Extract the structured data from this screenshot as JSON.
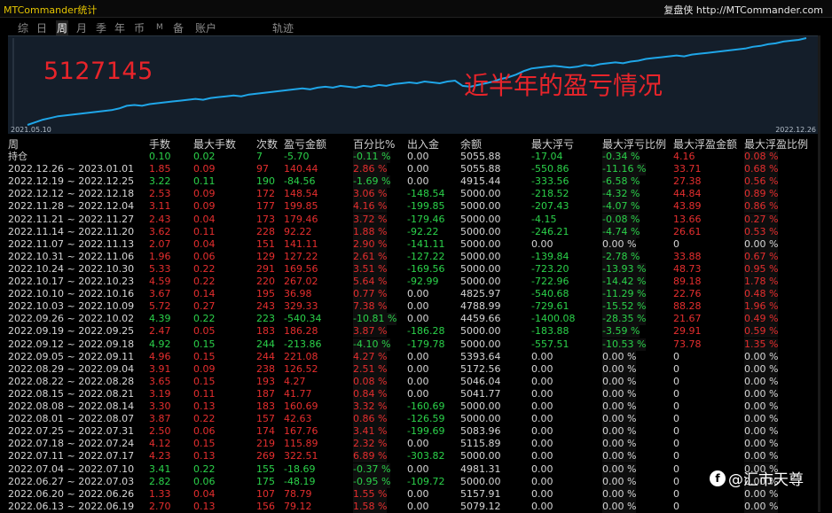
{
  "window": {
    "title": "MTCommander统计",
    "brand": "复盘侠 http://MTCommander.com"
  },
  "tabs": [
    {
      "label": "综",
      "active": false
    },
    {
      "label": "日",
      "active": false
    },
    {
      "label": "周",
      "active": true
    },
    {
      "label": "月",
      "active": false
    },
    {
      "label": "季",
      "active": false
    },
    {
      "label": "年",
      "active": false
    },
    {
      "label": "币",
      "active": false
    },
    {
      "label": "M",
      "active": false
    },
    {
      "label": "备",
      "active": false
    },
    {
      "label": "账户",
      "active": false
    },
    {
      "label": "轨迹",
      "active": false
    }
  ],
  "chart": {
    "overlay_number": "5127145",
    "overlay_caption": "近半年的盈亏情况",
    "date_start": "2021.05.10",
    "date_end": "2022.12.26",
    "line_color": "#1fa6e8",
    "points": [
      0.0,
      0.03,
      0.06,
      0.08,
      0.1,
      0.11,
      0.12,
      0.13,
      0.14,
      0.15,
      0.16,
      0.17,
      0.19,
      0.22,
      0.23,
      0.22,
      0.24,
      0.25,
      0.26,
      0.27,
      0.28,
      0.29,
      0.3,
      0.29,
      0.31,
      0.32,
      0.33,
      0.34,
      0.33,
      0.35,
      0.36,
      0.37,
      0.38,
      0.39,
      0.4,
      0.41,
      0.42,
      0.41,
      0.43,
      0.44,
      0.43,
      0.45,
      0.44,
      0.43,
      0.45,
      0.44,
      0.46,
      0.45,
      0.47,
      0.48,
      0.49,
      0.48,
      0.5,
      0.49,
      0.48,
      0.5,
      0.51,
      0.45,
      0.44,
      0.46,
      0.48,
      0.5,
      0.53,
      0.55,
      0.58,
      0.62,
      0.65,
      0.66,
      0.67,
      0.68,
      0.67,
      0.66,
      0.67,
      0.69,
      0.68,
      0.7,
      0.71,
      0.72,
      0.71,
      0.73,
      0.74,
      0.76,
      0.77,
      0.78,
      0.79,
      0.8,
      0.79,
      0.81,
      0.82,
      0.83,
      0.84,
      0.85,
      0.86,
      0.87,
      0.88,
      0.9,
      0.91,
      0.93,
      0.94,
      0.96,
      0.97,
      0.98,
      1.0
    ]
  },
  "table": {
    "headers": [
      "周",
      "手数",
      "最大手数",
      "次数",
      "盈亏金额",
      "百分比%",
      "出入金",
      "余额",
      "最大浮亏",
      "最大浮亏比例",
      "最大浮盈金额",
      "最大浮盈比例"
    ],
    "holding_row": {
      "period": "持仓",
      "lots": "0.10",
      "max_lots": "0.02",
      "count": "7",
      "pnl": "-5.70",
      "pct": "-0.11 %",
      "flow": "0.00",
      "balance": "5055.88",
      "max_dd": "-17.04",
      "max_dd_pct": "-0.34 %",
      "max_fp": "4.16",
      "max_fp_pct": "0.08 %",
      "sign": "neg"
    },
    "rows": [
      {
        "period": "2022.12.26 ~ 2023.01.01",
        "lots": "1.85",
        "max_lots": "0.09",
        "count": "97",
        "pnl": "140.44",
        "pct": "2.86 %",
        "flow": "0.00",
        "balance": "5055.88",
        "max_dd": "-550.86",
        "max_dd_pct": "-11.16 %",
        "max_fp": "33.71",
        "max_fp_pct": "0.68 %",
        "sign": "pos"
      },
      {
        "period": "2022.12.19 ~ 2022.12.25",
        "lots": "3.22",
        "max_lots": "0.11",
        "count": "190",
        "pnl": "-84.56",
        "pct": "-1.69 %",
        "flow": "0.00",
        "balance": "4915.44",
        "max_dd": "-333.56",
        "max_dd_pct": "-6.58 %",
        "max_fp": "27.38",
        "max_fp_pct": "0.56 %",
        "sign": "neg"
      },
      {
        "period": "2022.12.12 ~ 2022.12.18",
        "lots": "2.53",
        "max_lots": "0.09",
        "count": "172",
        "pnl": "148.54",
        "pct": "3.06 %",
        "flow": "-148.54",
        "balance": "5000.00",
        "max_dd": "-218.52",
        "max_dd_pct": "-4.32 %",
        "max_fp": "44.84",
        "max_fp_pct": "0.89 %",
        "sign": "pos"
      },
      {
        "period": "2022.11.28 ~ 2022.12.04",
        "lots": "3.11",
        "max_lots": "0.09",
        "count": "177",
        "pnl": "199.85",
        "pct": "4.16 %",
        "flow": "-199.85",
        "balance": "5000.00",
        "max_dd": "-207.43",
        "max_dd_pct": "-4.07 %",
        "max_fp": "43.89",
        "max_fp_pct": "0.86 %",
        "sign": "pos"
      },
      {
        "period": "2022.11.21 ~ 2022.11.27",
        "lots": "2.43",
        "max_lots": "0.04",
        "count": "173",
        "pnl": "179.46",
        "pct": "3.72 %",
        "flow": "-179.46",
        "balance": "5000.00",
        "max_dd": "-4.15",
        "max_dd_pct": "-0.08 %",
        "max_fp": "13.66",
        "max_fp_pct": "0.27 %",
        "sign": "pos"
      },
      {
        "period": "2022.11.14 ~ 2022.11.20",
        "lots": "3.62",
        "max_lots": "0.11",
        "count": "228",
        "pnl": "92.22",
        "pct": "1.88 %",
        "flow": "-92.22",
        "balance": "5000.00",
        "max_dd": "-246.21",
        "max_dd_pct": "-4.74 %",
        "max_fp": "26.61",
        "max_fp_pct": "0.53 %",
        "sign": "pos"
      },
      {
        "period": "2022.11.07 ~ 2022.11.13",
        "lots": "2.07",
        "max_lots": "0.04",
        "count": "151",
        "pnl": "141.11",
        "pct": "2.90 %",
        "flow": "-141.11",
        "balance": "5000.00",
        "max_dd": "0.00",
        "max_dd_pct": "0.00 %",
        "max_fp": "0",
        "max_fp_pct": "0.00 %",
        "sign": "pos"
      },
      {
        "period": "2022.10.31 ~ 2022.11.06",
        "lots": "1.96",
        "max_lots": "0.06",
        "count": "129",
        "pnl": "127.22",
        "pct": "2.61 %",
        "flow": "-127.22",
        "balance": "5000.00",
        "max_dd": "-139.84",
        "max_dd_pct": "-2.78 %",
        "max_fp": "33.88",
        "max_fp_pct": "0.67 %",
        "sign": "pos"
      },
      {
        "period": "2022.10.24 ~ 2022.10.30",
        "lots": "5.33",
        "max_lots": "0.22",
        "count": "291",
        "pnl": "169.56",
        "pct": "3.51 %",
        "flow": "-169.56",
        "balance": "5000.00",
        "max_dd": "-723.20",
        "max_dd_pct": "-13.93 %",
        "max_fp": "48.73",
        "max_fp_pct": "0.95 %",
        "sign": "pos"
      },
      {
        "period": "2022.10.17 ~ 2022.10.23",
        "lots": "4.59",
        "max_lots": "0.22",
        "count": "220",
        "pnl": "267.02",
        "pct": "5.64 %",
        "flow": "-92.99",
        "balance": "5000.00",
        "max_dd": "-722.96",
        "max_dd_pct": "-14.42 %",
        "max_fp": "89.18",
        "max_fp_pct": "1.78 %",
        "sign": "pos"
      },
      {
        "period": "2022.10.10 ~ 2022.10.16",
        "lots": "3.67",
        "max_lots": "0.14",
        "count": "195",
        "pnl": "36.98",
        "pct": "0.77 %",
        "flow": "0.00",
        "balance": "4825.97",
        "max_dd": "-540.68",
        "max_dd_pct": "-11.29 %",
        "max_fp": "22.76",
        "max_fp_pct": "0.48 %",
        "sign": "pos"
      },
      {
        "period": "2022.10.03 ~ 2022.10.09",
        "lots": "5.72",
        "max_lots": "0.27",
        "count": "243",
        "pnl": "329.33",
        "pct": "7.38 %",
        "flow": "0.00",
        "balance": "4788.99",
        "max_dd": "-729.61",
        "max_dd_pct": "-15.52 %",
        "max_fp": "88.28",
        "max_fp_pct": "1.96 %",
        "sign": "pos"
      },
      {
        "period": "2022.09.26 ~ 2022.10.02",
        "lots": "4.39",
        "max_lots": "0.22",
        "count": "223",
        "pnl": "-540.34",
        "pct": "-10.81 %",
        "flow": "0.00",
        "balance": "4459.66",
        "max_dd": "-1400.08",
        "max_dd_pct": "-28.35 %",
        "max_fp": "21.67",
        "max_fp_pct": "0.49 %",
        "sign": "neg"
      },
      {
        "period": "2022.09.19 ~ 2022.09.25",
        "lots": "2.47",
        "max_lots": "0.05",
        "count": "183",
        "pnl": "186.28",
        "pct": "3.87 %",
        "flow": "-186.28",
        "balance": "5000.00",
        "max_dd": "-183.88",
        "max_dd_pct": "-3.59 %",
        "max_fp": "29.91",
        "max_fp_pct": "0.59 %",
        "sign": "pos"
      },
      {
        "period": "2022.09.12 ~ 2022.09.18",
        "lots": "4.92",
        "max_lots": "0.15",
        "count": "244",
        "pnl": "-213.86",
        "pct": "-4.10 %",
        "flow": "-179.78",
        "balance": "5000.00",
        "max_dd": "-557.51",
        "max_dd_pct": "-10.53 %",
        "max_fp": "73.78",
        "max_fp_pct": "1.35 %",
        "sign": "neg"
      },
      {
        "period": "2022.09.05 ~ 2022.09.11",
        "lots": "4.96",
        "max_lots": "0.15",
        "count": "244",
        "pnl": "221.08",
        "pct": "4.27 %",
        "flow": "0.00",
        "balance": "5393.64",
        "max_dd": "0.00",
        "max_dd_pct": "0.00 %",
        "max_fp": "0",
        "max_fp_pct": "0.00 %",
        "sign": "pos"
      },
      {
        "period": "2022.08.29 ~ 2022.09.04",
        "lots": "3.91",
        "max_lots": "0.09",
        "count": "238",
        "pnl": "126.52",
        "pct": "2.51 %",
        "flow": "0.00",
        "balance": "5172.56",
        "max_dd": "0.00",
        "max_dd_pct": "0.00 %",
        "max_fp": "0",
        "max_fp_pct": "0.00 %",
        "sign": "pos"
      },
      {
        "period": "2022.08.22 ~ 2022.08.28",
        "lots": "3.65",
        "max_lots": "0.15",
        "count": "193",
        "pnl": "4.27",
        "pct": "0.08 %",
        "flow": "0.00",
        "balance": "5046.04",
        "max_dd": "0.00",
        "max_dd_pct": "0.00 %",
        "max_fp": "0",
        "max_fp_pct": "0.00 %",
        "sign": "pos"
      },
      {
        "period": "2022.08.15 ~ 2022.08.21",
        "lots": "3.19",
        "max_lots": "0.11",
        "count": "187",
        "pnl": "41.77",
        "pct": "0.84 %",
        "flow": "0.00",
        "balance": "5041.77",
        "max_dd": "0.00",
        "max_dd_pct": "0.00 %",
        "max_fp": "0",
        "max_fp_pct": "0.00 %",
        "sign": "pos"
      },
      {
        "period": "2022.08.08 ~ 2022.08.14",
        "lots": "3.30",
        "max_lots": "0.13",
        "count": "183",
        "pnl": "160.69",
        "pct": "3.32 %",
        "flow": "-160.69",
        "balance": "5000.00",
        "max_dd": "0.00",
        "max_dd_pct": "0.00 %",
        "max_fp": "0",
        "max_fp_pct": "0.00 %",
        "sign": "pos"
      },
      {
        "period": "2022.08.01 ~ 2022.08.07",
        "lots": "3.87",
        "max_lots": "0.22",
        "count": "157",
        "pnl": "42.63",
        "pct": "0.86 %",
        "flow": "-126.59",
        "balance": "5000.00",
        "max_dd": "0.00",
        "max_dd_pct": "0.00 %",
        "max_fp": "0",
        "max_fp_pct": "0.00 %",
        "sign": "pos"
      },
      {
        "period": "2022.07.25 ~ 2022.07.31",
        "lots": "2.50",
        "max_lots": "0.06",
        "count": "174",
        "pnl": "167.76",
        "pct": "3.41 %",
        "flow": "-199.69",
        "balance": "5083.96",
        "max_dd": "0.00",
        "max_dd_pct": "0.00 %",
        "max_fp": "0",
        "max_fp_pct": "0.00 %",
        "sign": "pos"
      },
      {
        "period": "2022.07.18 ~ 2022.07.24",
        "lots": "4.12",
        "max_lots": "0.15",
        "count": "219",
        "pnl": "115.89",
        "pct": "2.32 %",
        "flow": "0.00",
        "balance": "5115.89",
        "max_dd": "0.00",
        "max_dd_pct": "0.00 %",
        "max_fp": "0",
        "max_fp_pct": "0.00 %",
        "sign": "pos"
      },
      {
        "period": "2022.07.11 ~ 2022.07.17",
        "lots": "4.23",
        "max_lots": "0.13",
        "count": "269",
        "pnl": "322.51",
        "pct": "6.89 %",
        "flow": "-303.82",
        "balance": "5000.00",
        "max_dd": "0.00",
        "max_dd_pct": "0.00 %",
        "max_fp": "0",
        "max_fp_pct": "0.00 %",
        "sign": "pos"
      },
      {
        "period": "2022.07.04 ~ 2022.07.10",
        "lots": "3.41",
        "max_lots": "0.22",
        "count": "155",
        "pnl": "-18.69",
        "pct": "-0.37 %",
        "flow": "0.00",
        "balance": "4981.31",
        "max_dd": "0.00",
        "max_dd_pct": "0.00 %",
        "max_fp": "0",
        "max_fp_pct": "0.00 %",
        "sign": "neg"
      },
      {
        "period": "2022.06.27 ~ 2022.07.03",
        "lots": "2.82",
        "max_lots": "0.06",
        "count": "175",
        "pnl": "-48.19",
        "pct": "-0.95 %",
        "flow": "-109.72",
        "balance": "5000.00",
        "max_dd": "0.00",
        "max_dd_pct": "0.00 %",
        "max_fp": "0",
        "max_fp_pct": "0.00 %",
        "sign": "neg"
      },
      {
        "period": "2022.06.20 ~ 2022.06.26",
        "lots": "1.33",
        "max_lots": "0.04",
        "count": "107",
        "pnl": "78.79",
        "pct": "1.55 %",
        "flow": "0.00",
        "balance": "5157.91",
        "max_dd": "0.00",
        "max_dd_pct": "0.00 %",
        "max_fp": "0",
        "max_fp_pct": "0.00 %",
        "sign": "pos"
      },
      {
        "period": "2022.06.13 ~ 2022.06.19",
        "lots": "2.70",
        "max_lots": "0.13",
        "count": "156",
        "pnl": "79.12",
        "pct": "1.58 %",
        "flow": "0.00",
        "balance": "5079.12",
        "max_dd": "0.00",
        "max_dd_pct": "0.00 %",
        "max_fp": "0",
        "max_fp_pct": "0.00 %",
        "sign": "pos"
      }
    ]
  },
  "watermark": {
    "icon": "f-logo-icon",
    "text": "@汇市天尊"
  },
  "colors": {
    "profit": "#e52e2e",
    "loss": "#2bd24a",
    "neutral": "#d6d6d6",
    "title": "#e6c600",
    "overlay_text": "#e8242a"
  }
}
